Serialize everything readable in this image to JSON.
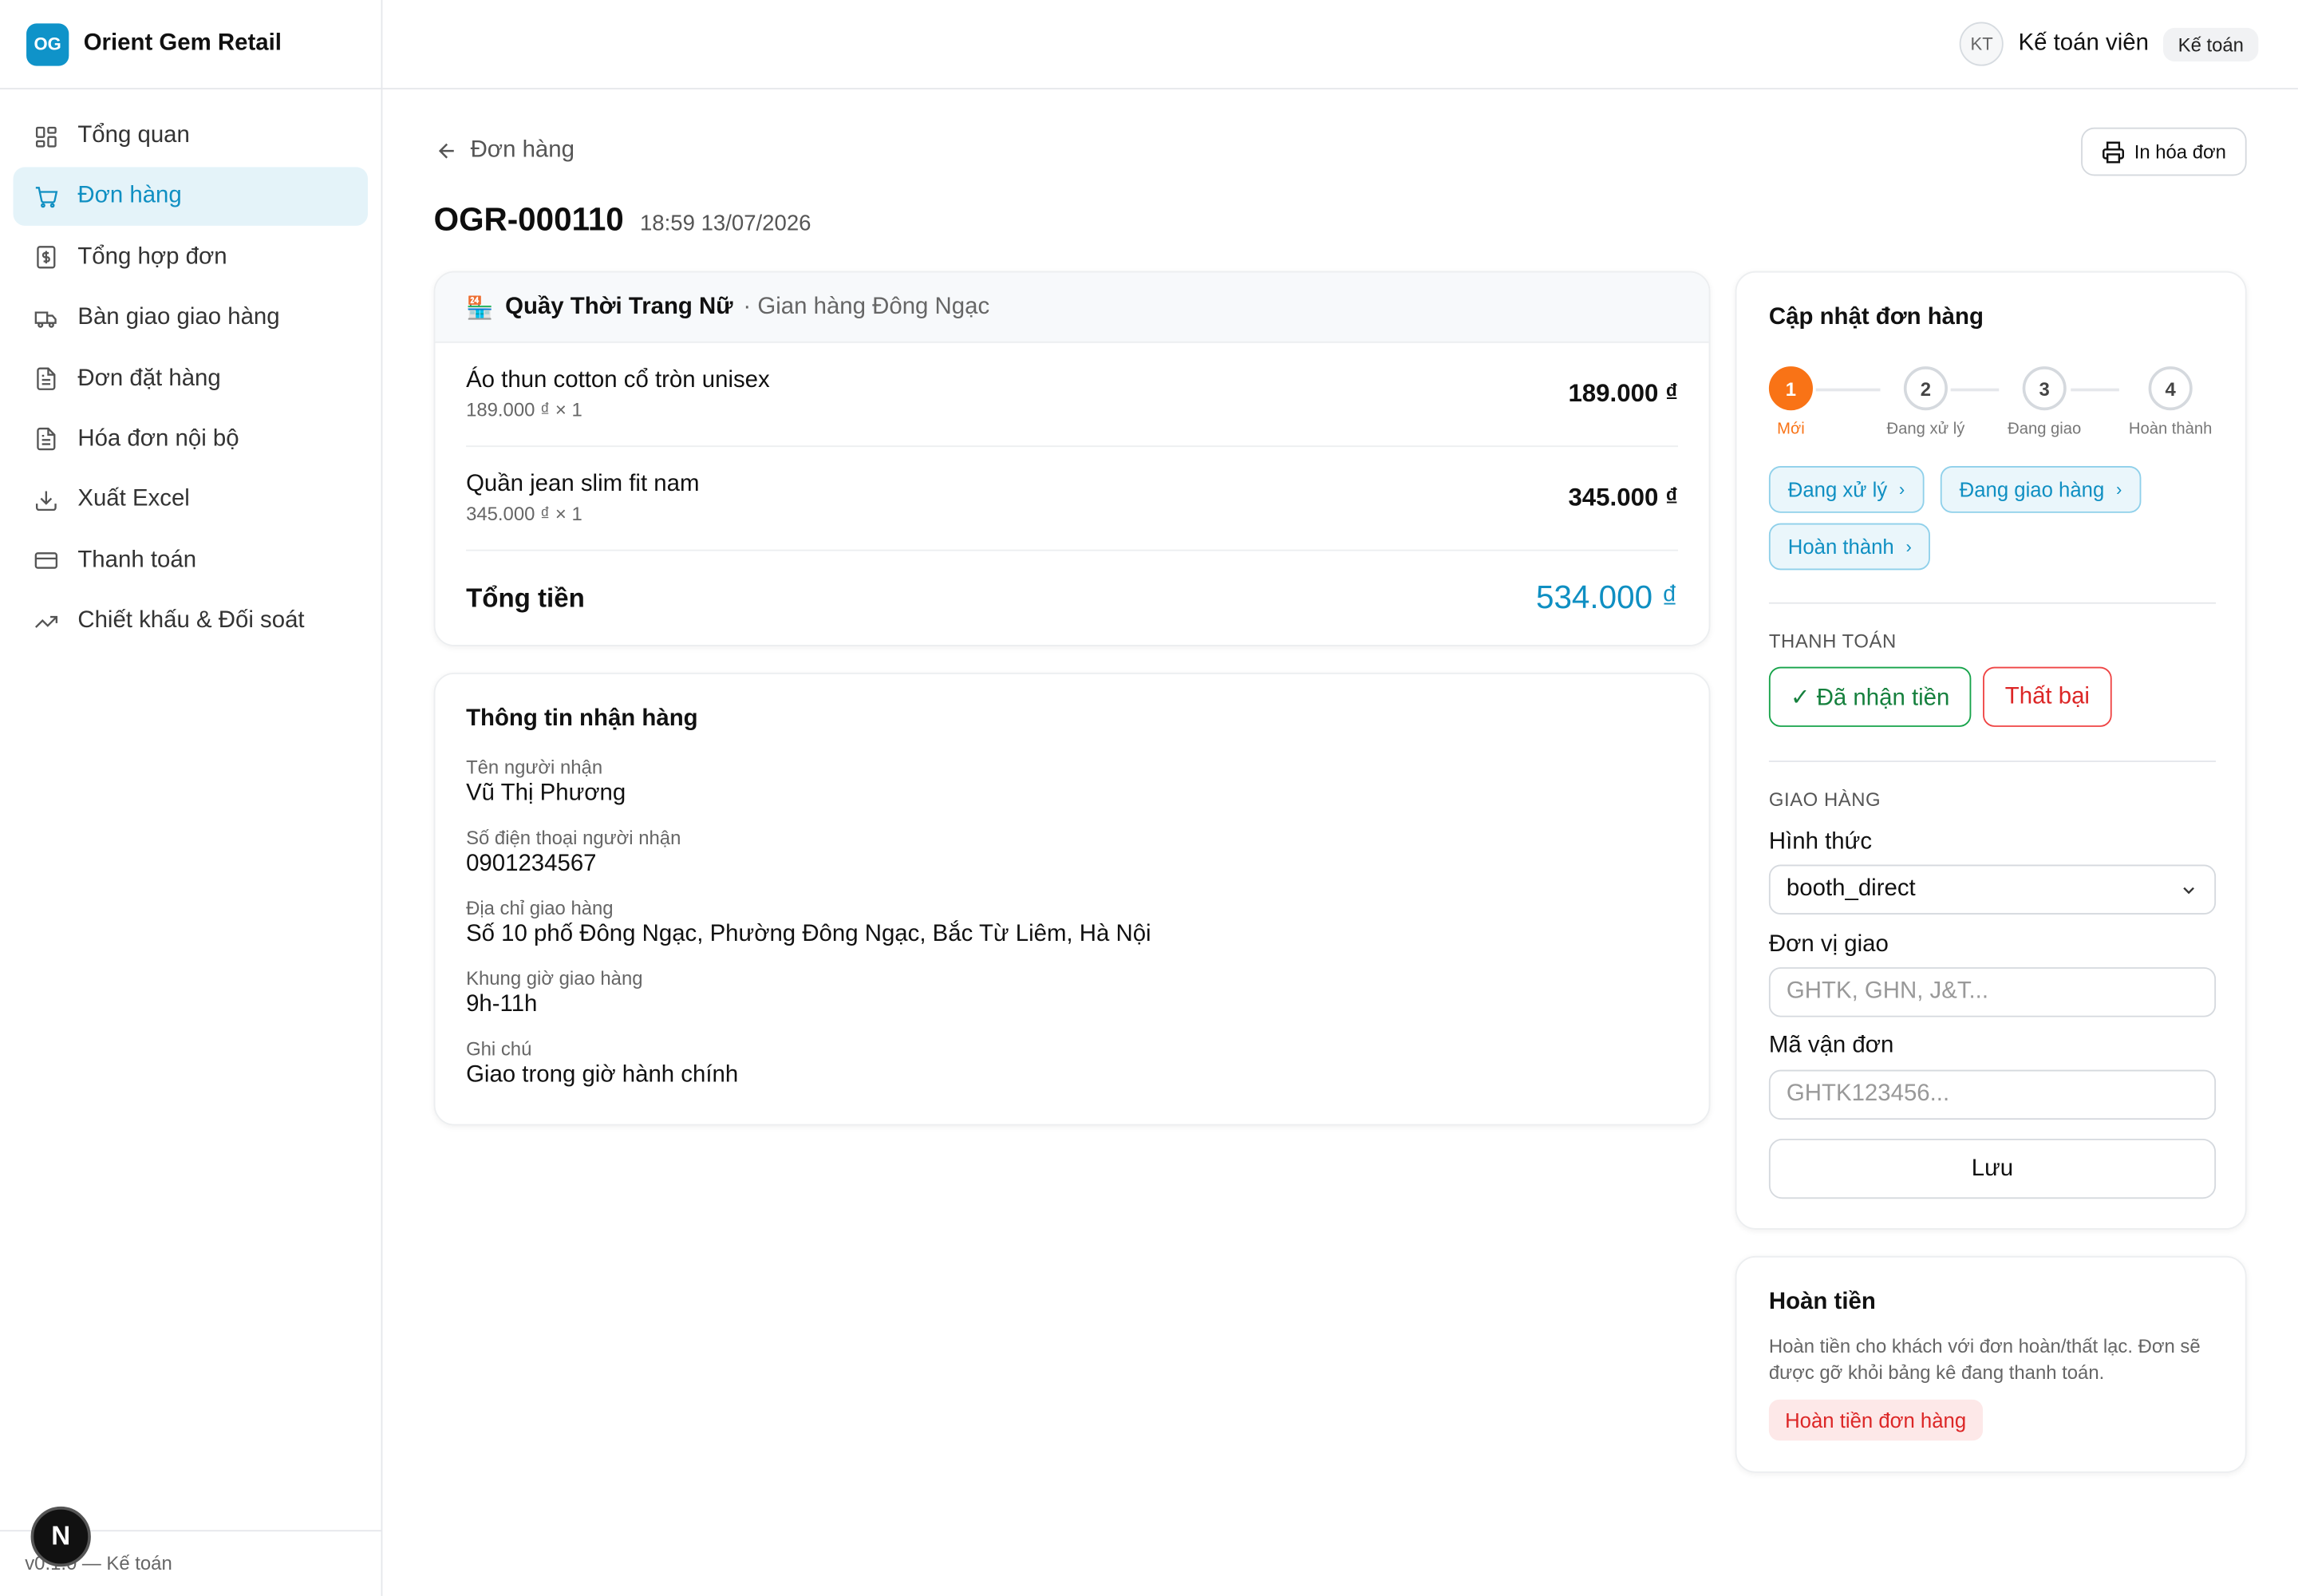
{
  "brand": {
    "logo": "OG",
    "name": "Orient Gem Retail"
  },
  "sidebar": {
    "items": [
      {
        "label": "Tổng quan",
        "icon": "grid-icon"
      },
      {
        "label": "Đơn hàng",
        "icon": "cart-icon",
        "active": true
      },
      {
        "label": "Tổng hợp đơn",
        "icon": "dollar-file-icon"
      },
      {
        "label": "Bàn giao giao hàng",
        "icon": "truck-icon"
      },
      {
        "label": "Đơn đặt hàng",
        "icon": "document-icon"
      },
      {
        "label": "Hóa đơn nội bộ",
        "icon": "document-icon"
      },
      {
        "label": "Xuất Excel",
        "icon": "download-icon"
      },
      {
        "label": "Thanh toán",
        "icon": "credit-card-icon"
      },
      {
        "label": "Chiết khấu & Đối soát",
        "icon": "trending-up-icon"
      }
    ],
    "footer": "v0.1.0 — Kế toán"
  },
  "header": {
    "avatar": "KT",
    "user_name": "Kế toán viên",
    "role": "Kế toán"
  },
  "page": {
    "back_label": "Đơn hàng",
    "print_label": "In hóa đơn",
    "order_id": "OGR-000110",
    "order_time": "18:59 13/07/2026"
  },
  "items_card": {
    "store_icon": "🏪",
    "store_name": "Quầy Thời Trang Nữ",
    "booth": "· Gian hàng Đông Ngạc",
    "items": [
      {
        "name": "Áo thun cotton cổ tròn unisex",
        "sub": "189.000 ₫ × 1",
        "price": "189.000 ₫"
      },
      {
        "name": "Quần jean slim fit nam",
        "sub": "345.000 ₫ × 1",
        "price": "345.000 ₫"
      }
    ],
    "total_label": "Tổng tiền",
    "total_value": "534.000 ₫"
  },
  "receiver": {
    "title": "Thông tin nhận hàng",
    "fields": [
      {
        "label": "Tên người nhận",
        "value": "Vũ Thị Phương"
      },
      {
        "label": "Số điện thoại người nhận",
        "value": "0901234567"
      },
      {
        "label": "Địa chỉ giao hàng",
        "value": "Số 10 phố Đông Ngạc, Phường Đông Ngạc, Bắc Từ Liêm, Hà Nội"
      },
      {
        "label": "Khung giờ giao hàng",
        "value": "9h-11h"
      },
      {
        "label": "Ghi chú",
        "value": "Giao trong giờ hành chính"
      }
    ]
  },
  "update": {
    "title": "Cập nhật đơn hàng",
    "steps": [
      {
        "num": "1",
        "label": "Mới"
      },
      {
        "num": "2",
        "label": "Đang xử lý"
      },
      {
        "num": "3",
        "label": "Đang giao"
      },
      {
        "num": "4",
        "label": "Hoàn thành"
      }
    ],
    "status_buttons": [
      "Đang xử lý",
      "Đang giao hàng",
      "Hoàn thành"
    ],
    "payment_label": "THANH TOÁN",
    "payment_ok": "✓ Đã nhận tiền",
    "payment_fail": "Thất bại",
    "shipping_label": "GIAO HÀNG",
    "method_label": "Hình thức",
    "method_value": "booth_direct",
    "carrier_label": "Đơn vị giao",
    "carrier_placeholder": "GHTK, GHN, J&T...",
    "tracking_label": "Mã vận đơn",
    "tracking_placeholder": "GHTK123456...",
    "save_label": "Lưu"
  },
  "refund": {
    "title": "Hoàn tiền",
    "description": "Hoàn tiền cho khách với đơn hoàn/thất lạc. Đơn sẽ được gỡ khỏi bảng kê đang thanh toán.",
    "button": "Hoàn tiền đơn hàng"
  },
  "colors": {
    "accent": "#0f8fc2",
    "step_current": "#f97316",
    "success": "#16a34a",
    "danger": "#dc2626"
  }
}
